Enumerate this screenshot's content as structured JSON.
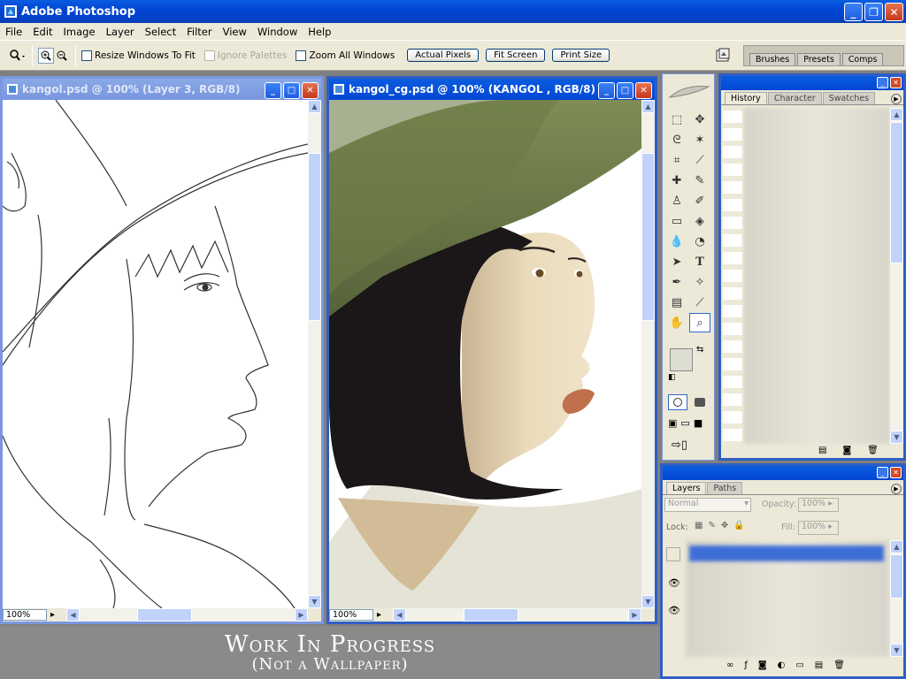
{
  "app": {
    "title": "Adobe Photoshop"
  },
  "menu": [
    "File",
    "Edit",
    "Image",
    "Layer",
    "Select",
    "Filter",
    "View",
    "Window",
    "Help"
  ],
  "options": {
    "resize_label": "Resize Windows To Fit",
    "ignore_label": "Ignore Palettes",
    "zoom_all_label": "Zoom All Windows",
    "actual_pixels": "Actual Pixels",
    "fit_screen": "Fit Screen",
    "print_size": "Print Size",
    "well_tabs": [
      "Brushes",
      "Presets",
      "Comps"
    ]
  },
  "doc1": {
    "title": "kangol.psd @ 100% (Layer 3, RGB/8)",
    "zoom": "100%"
  },
  "doc2": {
    "title": "kangol_cg.psd @ 100% (KANGOL , RGB/8)",
    "zoom": "100%"
  },
  "history_palette": {
    "tabs": [
      "History",
      "Character",
      "Swatches"
    ]
  },
  "layers_palette": {
    "tabs": [
      "Layers",
      "Paths"
    ],
    "blend_mode": "Normal",
    "opacity_label": "Opacity:",
    "opacity_value": "100%",
    "lock_label": "Lock:",
    "fill_label": "Fill:",
    "fill_value": "100%"
  },
  "caption": {
    "line1": "Work In Progress",
    "line2": "(Not a Wallpaper)"
  },
  "colors": {
    "accent": "#0a5ce0",
    "chrome": "#ece9d8",
    "hat": "#6b7a45"
  }
}
